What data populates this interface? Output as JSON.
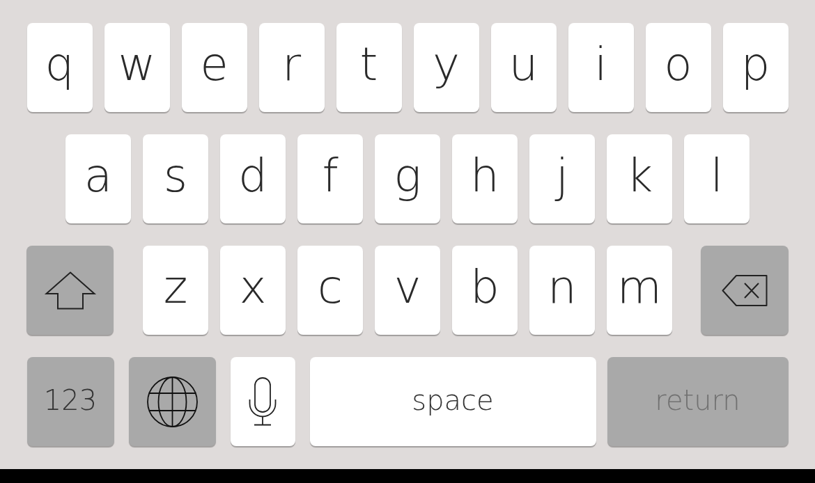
{
  "keyboard": {
    "rows": [
      {
        "keys": [
          {
            "kind": "letter",
            "label": "q"
          },
          {
            "kind": "letter",
            "label": "w"
          },
          {
            "kind": "letter",
            "label": "e"
          },
          {
            "kind": "letter",
            "label": "r"
          },
          {
            "kind": "letter",
            "label": "t"
          },
          {
            "kind": "letter",
            "label": "y"
          },
          {
            "kind": "letter",
            "label": "u"
          },
          {
            "kind": "letter",
            "label": "i"
          },
          {
            "kind": "letter",
            "label": "o"
          },
          {
            "kind": "letter",
            "label": "p"
          }
        ]
      },
      {
        "keys": [
          {
            "kind": "letter",
            "label": "a"
          },
          {
            "kind": "letter",
            "label": "s"
          },
          {
            "kind": "letter",
            "label": "d"
          },
          {
            "kind": "letter",
            "label": "f"
          },
          {
            "kind": "letter",
            "label": "g"
          },
          {
            "kind": "letter",
            "label": "h"
          },
          {
            "kind": "letter",
            "label": "j"
          },
          {
            "kind": "letter",
            "label": "k"
          },
          {
            "kind": "letter",
            "label": "l"
          }
        ]
      },
      {
        "keys": [
          {
            "kind": "shift"
          },
          {
            "kind": "letter",
            "label": "z"
          },
          {
            "kind": "letter",
            "label": "x"
          },
          {
            "kind": "letter",
            "label": "c"
          },
          {
            "kind": "letter",
            "label": "v"
          },
          {
            "kind": "letter",
            "label": "b"
          },
          {
            "kind": "letter",
            "label": "n"
          },
          {
            "kind": "letter",
            "label": "m"
          },
          {
            "kind": "backspace"
          }
        ]
      },
      {
        "keys": [
          {
            "kind": "numbers",
            "label": "123"
          },
          {
            "kind": "globe"
          },
          {
            "kind": "mic"
          },
          {
            "kind": "space",
            "label": "space"
          },
          {
            "kind": "return",
            "label": "return"
          }
        ]
      }
    ]
  }
}
